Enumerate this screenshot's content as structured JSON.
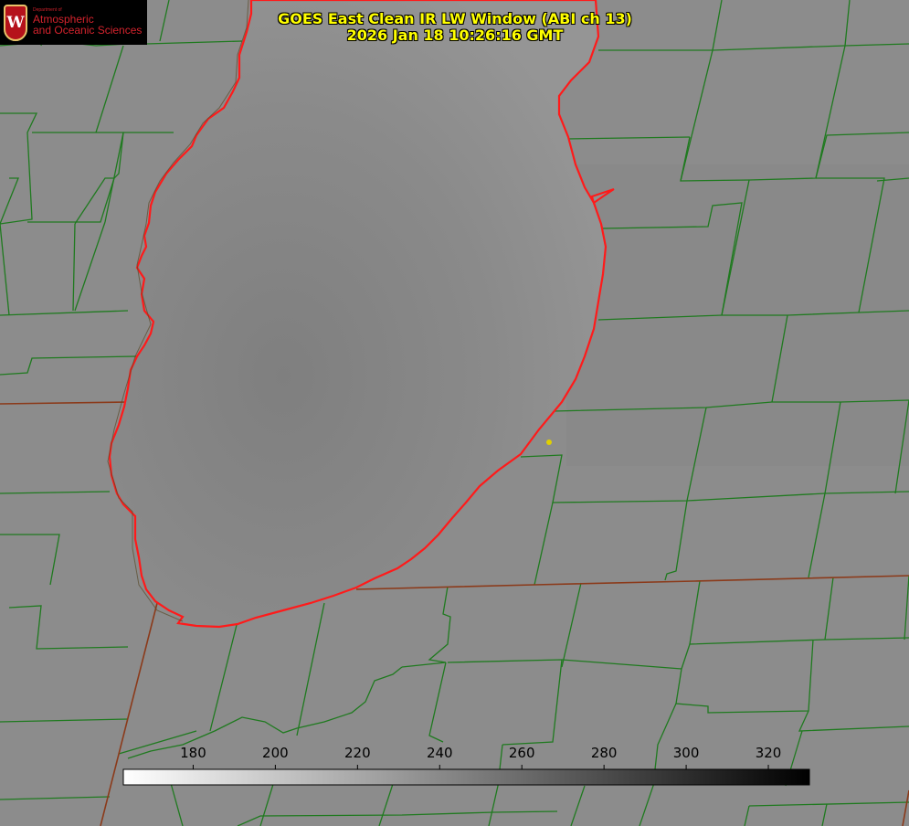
{
  "title": {
    "line1": "GOES East Clean IR LW Window (ABI ch 13)",
    "line2": "2026 Jan 18 10:26:16 GMT"
  },
  "logo": {
    "crest_letter": "W",
    "department": "Department of",
    "line1": "Atmospheric",
    "line2": "and Oceanic Sciences"
  },
  "colorbar": {
    "ticks": [
      "180",
      "200",
      "220",
      "240",
      "260",
      "280",
      "300",
      "320"
    ],
    "tick_values": [
      180,
      200,
      220,
      240,
      260,
      280,
      300,
      320
    ],
    "range": [
      163,
      330
    ],
    "gradient": [
      "#ffffff",
      "#000000"
    ]
  },
  "colors": {
    "coastline": "#ff1a1a",
    "county_lines": "#1f7a1f",
    "state_lines": "#8b3a1a",
    "lake_surface": "#8f8f8f",
    "land_surface": "#8c8c8c",
    "marker": "#e0d000"
  },
  "marker": {
    "name": "point marker"
  }
}
